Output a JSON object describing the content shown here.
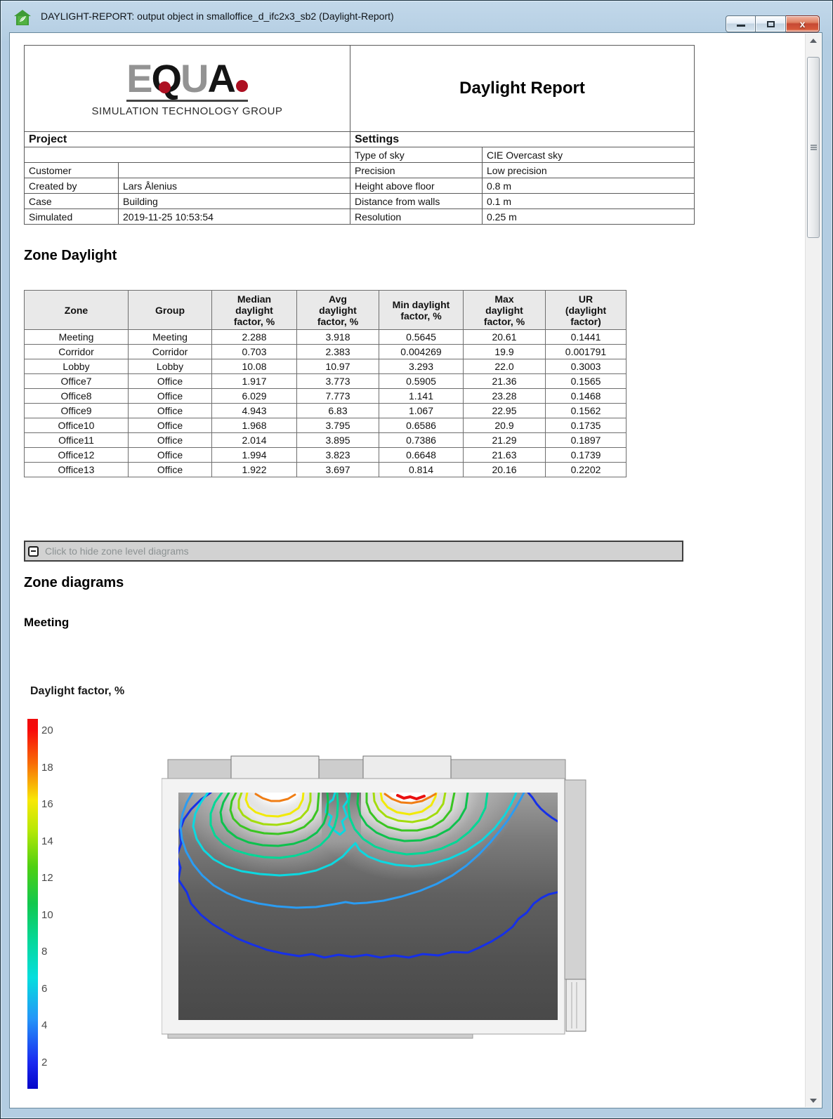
{
  "window": {
    "title": "DAYLIGHT-REPORT: output object in smalloffice_d_ifc2x3_sb2 (Daylight-Report)",
    "controls": {
      "minimize": "minimize",
      "maximize": "maximize",
      "close": "close"
    }
  },
  "logo": {
    "letter1": "E",
    "letter2": "Q",
    "letter3": "U",
    "letter4": "A",
    "subtitle": "SIMULATION TECHNOLOGY GROUP",
    "dot_color": "#ad1022"
  },
  "report": {
    "title": "Daylight Report"
  },
  "project": {
    "header": "Project",
    "rows": [
      {
        "label": "",
        "value": "",
        "full": true
      },
      {
        "label": "Customer",
        "value": ""
      },
      {
        "label": "Created by",
        "value": "Lars Ålenius"
      },
      {
        "label": "Case",
        "value": "Building"
      },
      {
        "label": "Simulated",
        "value": "2019-11-25 10:53:54"
      }
    ]
  },
  "settings": {
    "header": "Settings",
    "rows": [
      {
        "label": "Type of sky",
        "value": "CIE Overcast sky"
      },
      {
        "label": "Precision",
        "value": "Low precision"
      },
      {
        "label": "Height above floor",
        "value": "0.8 m"
      },
      {
        "label": "Distance from walls",
        "value": "0.1 m"
      },
      {
        "label": "Resolution",
        "value": "0.25 m"
      }
    ]
  },
  "zone_daylight": {
    "heading": "Zone Daylight",
    "columns": [
      "Zone",
      "Group",
      "Median\ndaylight\nfactor, %",
      "Avg\ndaylight\nfactor, %",
      "Min daylight\nfactor, %",
      "Max\ndaylight\nfactor, %",
      "UR\n(daylight\nfactor)"
    ],
    "rows": [
      [
        "Meeting",
        "Meeting",
        "2.288",
        "3.918",
        "0.5645",
        "20.61",
        "0.1441"
      ],
      [
        "Corridor",
        "Corridor",
        "0.703",
        "2.383",
        "0.004269",
        "19.9",
        "0.001791"
      ],
      [
        "Lobby",
        "Lobby",
        "10.08",
        "10.97",
        "3.293",
        "22.0",
        "0.3003"
      ],
      [
        "Office7",
        "Office",
        "1.917",
        "3.773",
        "0.5905",
        "21.36",
        "0.1565"
      ],
      [
        "Office8",
        "Office",
        "6.029",
        "7.773",
        "1.141",
        "23.28",
        "0.1468"
      ],
      [
        "Office9",
        "Office",
        "4.943",
        "6.83",
        "1.067",
        "22.95",
        "0.1562"
      ],
      [
        "Office10",
        "Office",
        "1.968",
        "3.795",
        "0.6586",
        "20.9",
        "0.1735"
      ],
      [
        "Office11",
        "Office",
        "2.014",
        "3.895",
        "0.7386",
        "21.29",
        "0.1897"
      ],
      [
        "Office12",
        "Office",
        "1.994",
        "3.823",
        "0.6648",
        "21.63",
        "0.1739"
      ],
      [
        "Office13",
        "Office",
        "1.922",
        "3.697",
        "0.814",
        "20.16",
        "0.2202"
      ]
    ]
  },
  "collapse_bar": {
    "label": "Click to hide zone level diagrams"
  },
  "zone_diagrams": {
    "heading": "Zone diagrams",
    "zone_heading": "Meeting"
  },
  "diagram": {
    "legend_title": "Daylight factor, %",
    "legend": {
      "ticks": [
        20,
        18,
        16,
        14,
        12,
        10,
        8,
        6,
        4,
        2
      ],
      "gradient": [
        [
          "#ef0b0b",
          "0%"
        ],
        [
          "#f80a0a",
          "3%"
        ],
        [
          "#f86c06",
          "12%"
        ],
        [
          "#f8e805",
          "22%"
        ],
        [
          "#b8e805",
          "30%"
        ],
        [
          "#4ed012",
          "40%"
        ],
        [
          "#12c84e",
          "50%"
        ],
        [
          "#05d89a",
          "60%"
        ],
        [
          "#05dede",
          "70%"
        ],
        [
          "#2496f8",
          "81%"
        ],
        [
          "#1a28f0",
          "93%"
        ],
        [
          "#0505c8",
          "100%"
        ]
      ]
    },
    "contours": {
      "levels_pct": [
        2,
        4,
        6,
        8,
        10,
        12,
        14,
        16,
        18,
        20
      ],
      "colors": {
        "2": "#1630e8",
        "4": "#2b9cf2",
        "6": "#0cd8e0",
        "8": "#00d896",
        "10": "#0cc24e",
        "12": "#3ac522",
        "14": "#a4dc0e",
        "16": "#f2ea06",
        "18": "#f07d14",
        "20": "#ea1111"
      }
    }
  },
  "chart_data": [
    {
      "type": "table",
      "title": "Zone Daylight",
      "columns": [
        "Zone",
        "Group",
        "Median daylight factor, %",
        "Avg daylight factor, %",
        "Min daylight factor, %",
        "Max daylight factor, %",
        "UR (daylight factor)"
      ],
      "rows": [
        [
          "Meeting",
          "Meeting",
          2.288,
          3.918,
          0.5645,
          20.61,
          0.1441
        ],
        [
          "Corridor",
          "Corridor",
          0.703,
          2.383,
          0.004269,
          19.9,
          0.001791
        ],
        [
          "Lobby",
          "Lobby",
          10.08,
          10.97,
          3.293,
          22.0,
          0.3003
        ],
        [
          "Office7",
          "Office",
          1.917,
          3.773,
          0.5905,
          21.36,
          0.1565
        ],
        [
          "Office8",
          "Office",
          6.029,
          7.773,
          1.141,
          23.28,
          0.1468
        ],
        [
          "Office9",
          "Office",
          4.943,
          6.83,
          1.067,
          22.95,
          0.1562
        ],
        [
          "Office10",
          "Office",
          1.968,
          3.795,
          0.6586,
          20.9,
          0.1735
        ],
        [
          "Office11",
          "Office",
          2.014,
          3.895,
          0.7386,
          21.29,
          0.1897
        ],
        [
          "Office12",
          "Office",
          1.994,
          3.823,
          0.6648,
          21.63,
          0.1739
        ],
        [
          "Office13",
          "Office",
          1.922,
          3.697,
          0.814,
          20.16,
          0.2202
        ]
      ]
    },
    {
      "type": "heatmap",
      "title": "Meeting",
      "legend_title": "Daylight factor, %",
      "legend_ticks": [
        20,
        18,
        16,
        14,
        12,
        10,
        8,
        6,
        4,
        2
      ],
      "contour_levels_pct": [
        2,
        4,
        6,
        8,
        10,
        12,
        14,
        16,
        18,
        20
      ],
      "colormap": "rainbow (red = 20%, blue = 2%)",
      "description": "Floor-plan contour map of daylight factor for zone Meeting: two bright maxima (up to ~20%) directly inside the two windows on the top wall, values fall off concentrically to ~2% near the opposite (bottom) wall"
    }
  ]
}
